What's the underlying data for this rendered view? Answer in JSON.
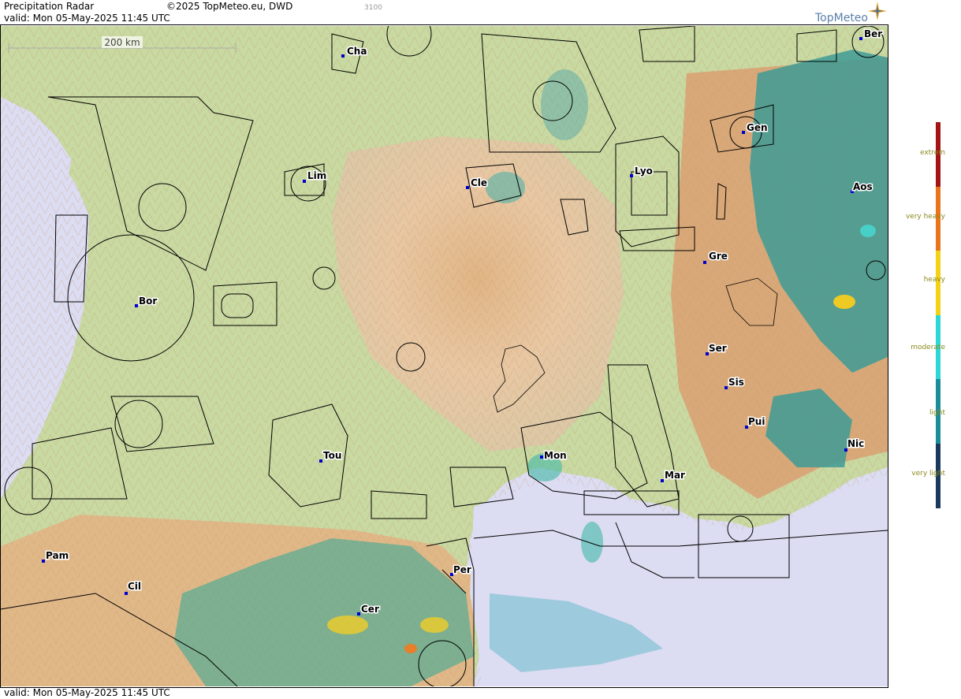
{
  "header": {
    "title": "Precipitation Radar",
    "copyright": "©2025 TopMeteo.eu, DWD",
    "valid": "valid:  Mon  05-May-2025 11:45 UTC",
    "code": "3100",
    "logo": "TopMeteo"
  },
  "footer": {
    "valid": "valid:  Mon  05-May-2025 11:45 UTC"
  },
  "scale": {
    "label": "200 km"
  },
  "cities": [
    {
      "name": "Cha"
    },
    {
      "name": "Ber"
    },
    {
      "name": "Gen"
    },
    {
      "name": "Lim"
    },
    {
      "name": "Cle"
    },
    {
      "name": "Lyo"
    },
    {
      "name": "Aos"
    },
    {
      "name": "Gre"
    },
    {
      "name": "Bor"
    },
    {
      "name": "Ser"
    },
    {
      "name": "Sis"
    },
    {
      "name": "Pui"
    },
    {
      "name": "Nic"
    },
    {
      "name": "Tou"
    },
    {
      "name": "Mon"
    },
    {
      "name": "Mar"
    },
    {
      "name": "Pam"
    },
    {
      "name": "Cil"
    },
    {
      "name": "Per"
    },
    {
      "name": "Cer"
    }
  ],
  "legend": {
    "items": [
      {
        "label": "extrem",
        "color": "#a31515"
      },
      {
        "label": "very heavy",
        "color": "#e8751a"
      },
      {
        "label": "heavy",
        "color": "#f2d116"
      },
      {
        "label": "moderate",
        "color": "#2fd6d6"
      },
      {
        "label": "light",
        "color": "#1c8c9a"
      },
      {
        "label": "very light",
        "color": "#1a3a5c"
      }
    ]
  }
}
